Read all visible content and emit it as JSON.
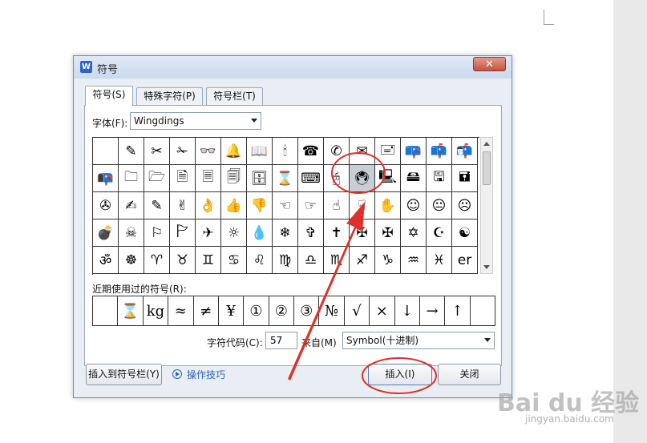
{
  "dialog": {
    "app_icon": "W",
    "title": "符号",
    "close_glyph": "✕"
  },
  "tabs": [
    {
      "label": "符号(S)",
      "active": true
    },
    {
      "label": "特殊字符(P)",
      "active": false
    },
    {
      "label": "符号栏(T)",
      "active": false
    }
  ],
  "font": {
    "label": "字体(F):",
    "value": "Wingdings"
  },
  "symbols": [
    [
      "",
      "✎",
      "✂",
      "✁",
      "👓",
      "🔔",
      "📖",
      "🕯",
      "☎",
      "✆",
      "✉",
      "🖃",
      "📪",
      "📫",
      "📬"
    ],
    [
      "📭",
      "🗀",
      "🗁",
      "🗎",
      "🗏",
      "🗐",
      "🗄",
      "⌛",
      "⌨",
      "🖰",
      "🖲",
      "🖳",
      "🖴",
      "🖫",
      "🖬"
    ],
    [
      "✇",
      "✍",
      "✎",
      "✌",
      "👌",
      "👍",
      "👎",
      "☜",
      "☞",
      "☝",
      "☟",
      "✋",
      "☺",
      "😐",
      "☹"
    ],
    [
      "💣",
      "☠",
      "⚐",
      "🏱",
      "✈",
      "☼",
      "💧",
      "❄",
      "✞",
      "✝",
      "✠",
      "✠",
      "✡",
      "☪",
      "☯"
    ],
    [
      "ॐ",
      "☸",
      "♈",
      "♉",
      "♊",
      "♋",
      "♌",
      "♍",
      "♎",
      "♏",
      "♐",
      "♑",
      "♒",
      "♓",
      "er"
    ]
  ],
  "selected_symbol": {
    "row": 1,
    "col": 10
  },
  "recent": {
    "label": "近期使用过的符号(R):",
    "items": [
      "",
      "⌛",
      "kg",
      "≈",
      "≠",
      "¥",
      "①",
      "②",
      "③",
      "№",
      "√",
      "×",
      "↓",
      "→",
      "↑",
      ""
    ]
  },
  "char_code": {
    "label": "字符代码(C):",
    "value": "57",
    "from_label": "来自(M)",
    "from_value": "Symbol(十进制)"
  },
  "buttons": {
    "insert_to_bar": "插入到符号栏(Y)",
    "tips": "操作技巧",
    "insert": "插入(I)",
    "close": "关闭"
  },
  "watermark": {
    "logo": "Bai du 经验",
    "sub": "jingyan.baidu.com"
  },
  "colors": {
    "annotation": "#e0302a",
    "title_bar": "#d6e3f3",
    "link": "#2c63b5"
  }
}
